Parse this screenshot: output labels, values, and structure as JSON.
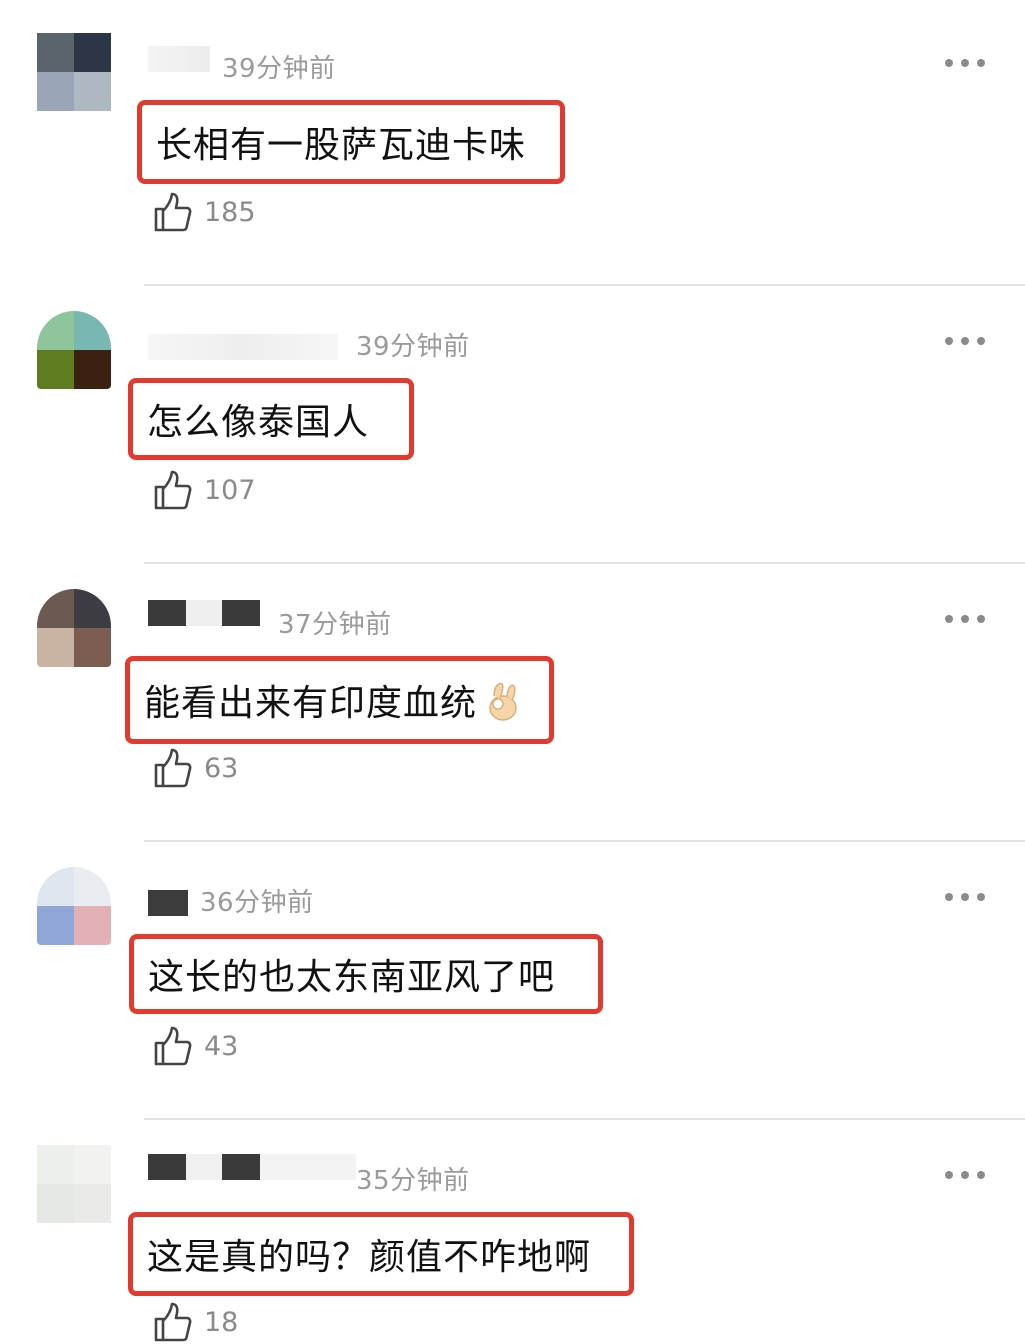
{
  "comments": [
    {
      "time": "39分钟前",
      "text": "长相有一股萨瓦迪卡味",
      "likes": "185",
      "avatar_colors": [
        "#5a646b",
        "#2d3646",
        "#9aa6b8",
        "#aeb8c2"
      ],
      "icons": [
        "more-icon",
        "thumbs-up-icon"
      ]
    },
    {
      "time": "39分钟前",
      "text": "怎么像泰国人",
      "likes": "107",
      "avatar_colors": [
        "#8fc59a",
        "#79b7b3",
        "#5f7d20",
        "#3c2010"
      ]
    },
    {
      "time": "37分钟前",
      "text": "能看出来有印度血统",
      "emoji": "ok-hand-emoji",
      "likes": "63",
      "avatar_colors": [
        "#6a5a52",
        "#3c3c42",
        "#c9b4a4",
        "#7b5c50"
      ]
    },
    {
      "time": "36分钟前",
      "text": "这长的也太东南亚风了吧",
      "likes": "43",
      "avatar_colors": [
        "#dfe6ee",
        "#e9ecf0",
        "#8fa6d7",
        "#e3b0b5"
      ]
    },
    {
      "time": "35分钟前",
      "text": "这是真的吗？颜值不咋地啊",
      "likes": "18",
      "avatar_colors": [
        "#ecefea",
        "#f2f2f0",
        "#e6e8e4",
        "#eaeae8"
      ]
    }
  ]
}
